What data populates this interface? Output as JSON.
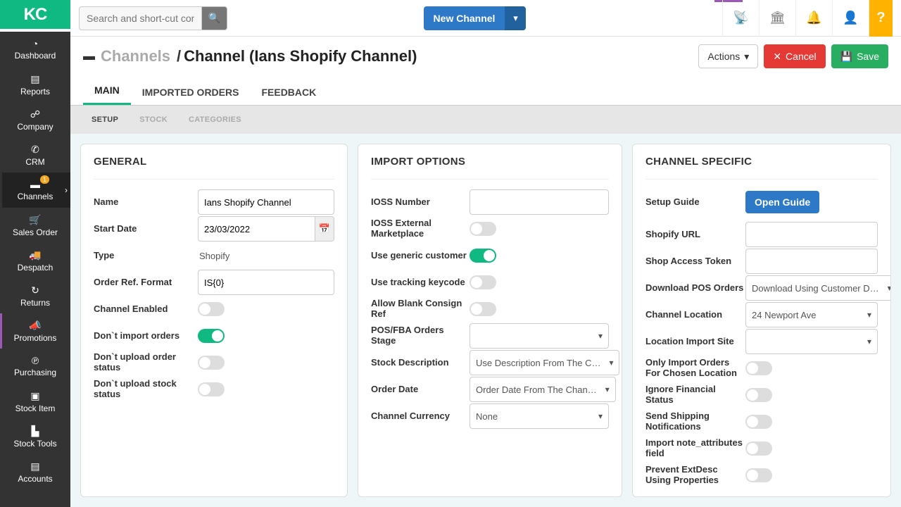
{
  "logo": "KC",
  "sidebar": {
    "items": [
      {
        "label": "Dashboard",
        "icon": "◔"
      },
      {
        "label": "Reports",
        "icon": "▤"
      },
      {
        "label": "Company",
        "icon": "☍"
      },
      {
        "label": "CRM",
        "icon": "✆"
      },
      {
        "label": "Channels",
        "icon": "▬",
        "badge": "1",
        "chev": true,
        "active": true
      },
      {
        "label": "Sales Order",
        "icon": "🛒"
      },
      {
        "label": "Despatch",
        "icon": "🚚"
      },
      {
        "label": "Returns",
        "icon": "↻"
      },
      {
        "label": "Promotions",
        "icon": "📣"
      },
      {
        "label": "Purchasing",
        "icon": "℗"
      },
      {
        "label": "Stock Item",
        "icon": "▣"
      },
      {
        "label": "Stock Tools",
        "icon": "▙"
      },
      {
        "label": "Accounts",
        "icon": "▤"
      }
    ]
  },
  "topbar": {
    "search_placeholder": "Search and short-cut commands",
    "new_label": "New Channel",
    "help": "?"
  },
  "header": {
    "crumb": "Channels",
    "sep": "/",
    "title": "Channel (Ians Shopify Channel)",
    "actions": "Actions",
    "cancel": "Cancel",
    "save": "Save"
  },
  "tabs": {
    "main": "MAIN",
    "imported": "IMPORTED ORDERS",
    "feedback": "FEEDBACK"
  },
  "subtabs": {
    "setup": "SETUP",
    "stock": "STOCK",
    "categories": "CATEGORIES"
  },
  "general": {
    "title": "GENERAL",
    "name_l": "Name",
    "name_v": "Ians Shopify Channel",
    "start_l": "Start Date",
    "start_v": "23/03/2022",
    "type_l": "Type",
    "type_v": "Shopify",
    "order_ref_l": "Order Ref. Format",
    "order_ref_v": "IS{0}",
    "enabled_l": "Channel Enabled",
    "dont_import_l": "Don`t import orders",
    "dont_upload_order_l": "Don`t upload order status",
    "dont_upload_stock_l": "Don`t upload stock status"
  },
  "import": {
    "title": "IMPORT OPTIONS",
    "ioss_l": "IOSS Number",
    "ioss_v": "",
    "ioss_ext_l": "IOSS External Marketplace",
    "generic_l": "Use generic customer",
    "tracking_l": "Use tracking keycode",
    "blank_l": "Allow Blank Consign Ref",
    "pos_stage_l": "POS/FBA Orders Stage",
    "pos_stage_v": "",
    "stock_desc_l": "Stock Description",
    "stock_desc_v": "Use Description From The C…",
    "order_date_l": "Order Date",
    "order_date_v": "Order Date From The Chan…",
    "currency_l": "Channel Currency",
    "currency_v": "None"
  },
  "specific": {
    "title": "CHANNEL SPECIFIC",
    "setup_guide_l": "Setup Guide",
    "open_guide": "Open Guide",
    "url_l": "Shopify URL",
    "url_v": "",
    "token_l": "Shop Access Token",
    "token_v": "",
    "dl_pos_l": "Download POS Orders",
    "dl_pos_v": "Download Using Customer D…",
    "loc_l": "Channel Location",
    "loc_v": "24 Newport Ave",
    "loc_import_l": "Location Import Site",
    "loc_import_v": "",
    "only_import_l": "Only Import Orders For Chosen Location",
    "ignore_fin_l": "Ignore Financial Status",
    "send_ship_l": "Send Shipping Notifications",
    "import_note_l": "Import note_attributes field",
    "prevent_ext_l": "Prevent ExtDesc Using Properties"
  }
}
